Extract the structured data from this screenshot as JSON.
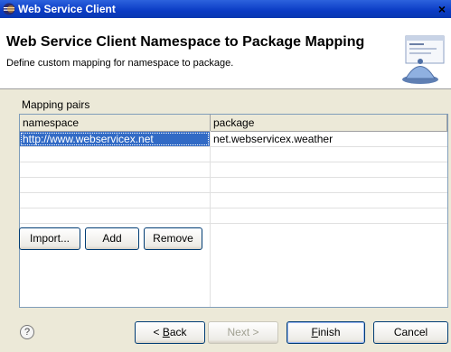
{
  "window": {
    "title": "Web Service Client",
    "close_glyph": "×"
  },
  "header": {
    "heading": "Web Service Client Namespace to Package Mapping",
    "description": "Define custom mapping for namespace to package."
  },
  "mapping": {
    "group_label": "Mapping pairs",
    "columns": [
      "namespace",
      "package"
    ],
    "rows": [
      {
        "namespace": "http://www.webservicex.net",
        "package": "net.webservicex.weather",
        "selected": true
      },
      {
        "namespace": "",
        "package": ""
      },
      {
        "namespace": "",
        "package": ""
      },
      {
        "namespace": "",
        "package": ""
      },
      {
        "namespace": "",
        "package": ""
      },
      {
        "namespace": "",
        "package": ""
      }
    ],
    "buttons": {
      "import": "Import...",
      "add": "Add",
      "remove": "Remove"
    }
  },
  "footer": {
    "help_glyph": "?",
    "back_prefix": "< ",
    "back_mnemonic": "B",
    "back_rest": "ack",
    "next_label": "Next >",
    "finish_mnemonic": "F",
    "finish_rest": "inish",
    "cancel_label": "Cancel"
  },
  "colors": {
    "title_bar": "#0a3bc4",
    "selection": "#316ac5",
    "dialog_bg": "#ece9d8"
  },
  "icons": {
    "app": "eclipse-icon",
    "banner": "web-service-wizard-icon",
    "help": "help-icon"
  }
}
